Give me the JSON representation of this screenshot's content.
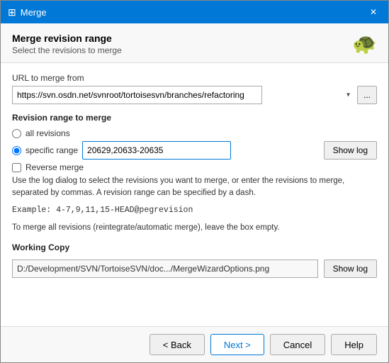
{
  "window": {
    "title": "Merge",
    "close_label": "✕"
  },
  "header": {
    "title": "Merge revision range",
    "subtitle": "Select the revisions to merge",
    "logo": "🐢"
  },
  "url_section": {
    "label": "URL to merge from",
    "url_value": "https://svn.osdn.net/svnroot/tortoisesvn/branches/refactoring",
    "browse_label": "..."
  },
  "revision_section": {
    "label": "Revision range to merge",
    "all_revisions_label": "all revisions",
    "specific_range_label": "specific range",
    "range_value": "20629,20633-20635",
    "show_log_label": "Show log",
    "reverse_merge_label": "Reverse merge",
    "info_text": "Use the log dialog to select the revisions you want to merge, or enter the revisions to merge, separated by commas. A revision range can be specified by a dash.",
    "example_label": "Example: 4-7,9,11,15-HEAD@pegrevision",
    "note_text": "To merge all revisions (reintegrate/automatic merge), leave the box empty."
  },
  "working_copy_section": {
    "label": "Working Copy",
    "path_value": "D:/Development/SVN/TortoiseSVN/doc.../MergeWizardOptions.png",
    "show_log_label": "Show log"
  },
  "footer": {
    "back_label": "< Back",
    "next_label": "Next >",
    "cancel_label": "Cancel",
    "help_label": "Help"
  }
}
